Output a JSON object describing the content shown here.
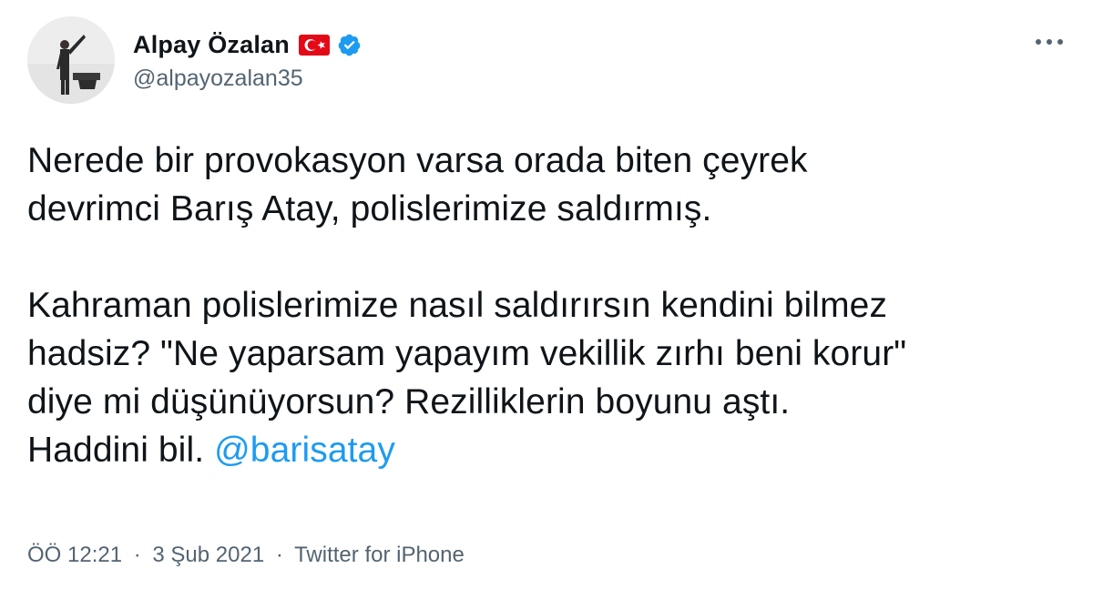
{
  "author": {
    "display_name": "Alpay Özalan",
    "handle": "@alpayozalan35",
    "flag_icon": "turkey-flag-icon",
    "verified_icon": "verified-badge-icon"
  },
  "colors": {
    "text": "#0f1419",
    "secondary": "#536471",
    "link": "#1d9bf0",
    "verified": "#1d9bf0",
    "flag_red": "#e30a17"
  },
  "tweet": {
    "paragraph1": [
      "Nerede bir provokasyon varsa orada biten çeyrek",
      "devrimci Barış Atay, polislerimize saldırmış."
    ],
    "paragraph2": [
      "Kahraman polislerimize nasıl saldırırsın kendini bilmez",
      "hadsiz? \"Ne yaparsam yapayım vekillik zırhı beni korur\"",
      "diye mi düşünüyorsun? Rezilliklerin boyunu aştı.",
      "Haddini bil. "
    ],
    "mention": "@barisatay"
  },
  "meta": {
    "time": "ÖÖ 12:21",
    "separator": "·",
    "date": "3 Şub 2021",
    "source": "Twitter for iPhone"
  },
  "more_icon": "more-options-icon"
}
